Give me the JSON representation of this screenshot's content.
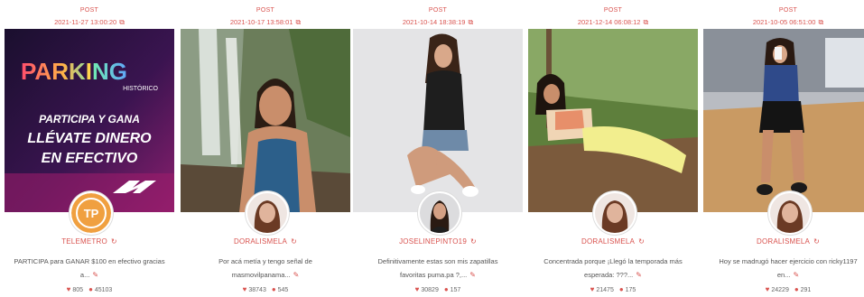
{
  "posts": [
    {
      "type": "POST",
      "date": "2021-11-27 13:00:20",
      "username": "TELEMETRO",
      "caption_line1": "PARTICIPA para GANAR $100 en efectivo gracias",
      "caption_line2": "a...",
      "likes": "805",
      "comments": "45103",
      "banner": {
        "logo_prefix": "PARK",
        "logo_i": "I",
        "logo_suffix": "NG",
        "logo_sub": "HISTÓRICO",
        "line1": "PARTICIPA Y GANA",
        "line2": "LLÉVATE DINERO",
        "line3": "EN EFECTIVO",
        "avatar_text": "TP"
      }
    },
    {
      "type": "POST",
      "date": "2021-10-17 13:58:01",
      "username": "DORALISMELA",
      "caption_line1": "Por acá metía y tengo señal de",
      "caption_line2": "masmovilpanama...",
      "likes": "38743",
      "comments": "545"
    },
    {
      "type": "POST",
      "date": "2021-10-14 18:38:19",
      "username": "JOSELINEPINTO19",
      "caption_line1": "Definitivamente estas son mis zapatillas",
      "caption_line2": "favoritas puma.pa ?,...",
      "likes": "30829",
      "comments": "157"
    },
    {
      "type": "POST",
      "date": "2021-12-14 06:08:12",
      "username": "DORALISMELA",
      "caption_line1": "Concentrada porque ¡Llegó la temporada más",
      "caption_line2": "esperada: ???...",
      "likes": "21475",
      "comments": "175"
    },
    {
      "type": "POST",
      "date": "2021-10-05 06:51:00",
      "username": "DORALISMELA",
      "caption_line1": "Hoy se madrugó hacer ejercicio con ricky1197",
      "caption_line2": "en...",
      "likes": "24229",
      "comments": "291"
    }
  ],
  "colors": {
    "accent": "#d9534f"
  },
  "icons": {
    "external": "external-link-icon",
    "refresh": "refresh-icon",
    "edit": "pencil-icon",
    "like": "heart-icon",
    "comment": "comment-icon"
  }
}
